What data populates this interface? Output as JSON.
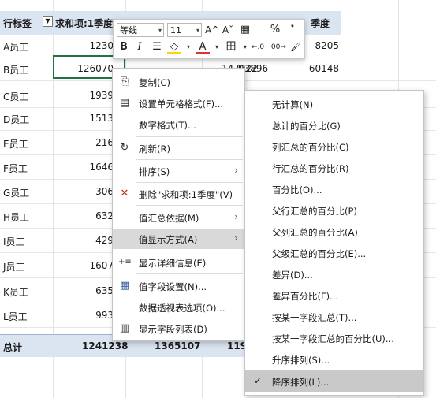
{
  "sheet": {
    "header": {
      "row_label": "行标签",
      "filter_icon": "▼",
      "col1": "求和项:1季度",
      "col4": "季度"
    },
    "rows": [
      {
        "label": "A员工",
        "q1": "1230",
        "q4": "8205"
      },
      {
        "label": "B员工",
        "q1": "126070",
        "q2": "147022",
        "q3": "93896",
        "q4": "60148"
      },
      {
        "label": "C员工",
        "q1": "1939"
      },
      {
        "label": "D员工",
        "q1": "1513"
      },
      {
        "label": "E员工",
        "q1": "216"
      },
      {
        "label": "F员工",
        "q1": "1646"
      },
      {
        "label": "G员工",
        "q1": "306"
      },
      {
        "label": "H员工",
        "q1": "632"
      },
      {
        "label": "I员工",
        "q1": "429"
      },
      {
        "label": "J员工",
        "q1": "1607"
      },
      {
        "label": "K员工",
        "q1": "635"
      },
      {
        "label": "L员工",
        "q1": "993"
      }
    ],
    "total": {
      "label": "总计",
      "q1": "1241238",
      "q2": "1365107",
      "q3": "119"
    }
  },
  "minibar": {
    "font": "等线",
    "size": "11",
    "icons": {
      "grow": "A^",
      "shrink": "Aˇ",
      "percent": "%",
      "comma": "❜",
      "bold": "B",
      "italic": "I",
      "align": "☰",
      "fill": "◇",
      "font_color": "A",
      "borders": "田",
      "dec_inc": "←.0",
      "dec_dec": ".00→",
      "brush": "🖌"
    }
  },
  "context_menu": {
    "items": [
      {
        "label": "复制(C)",
        "icon": "⎘"
      },
      {
        "label": "设置单元格格式(F)...",
        "icon": "▤"
      },
      {
        "label": "数字格式(T)...",
        "icon": ""
      },
      {
        "label": "刷新(R)",
        "icon": "↻"
      },
      {
        "label": "排序(S)",
        "icon": "",
        "arrow": "›"
      },
      {
        "label": "删除\"求和项:1季度\"(V)",
        "icon": "✕"
      },
      {
        "label": "值汇总依据(M)",
        "icon": "",
        "arrow": "›"
      },
      {
        "label": "值显示方式(A)",
        "icon": "",
        "arrow": "›"
      },
      {
        "label": "显示详细信息(E)",
        "icon": "+≡"
      },
      {
        "label": "值字段设置(N)...",
        "icon": "▦"
      },
      {
        "label": "数据透视表选项(O)...",
        "icon": ""
      },
      {
        "label": "显示字段列表(D)",
        "icon": "▥"
      }
    ]
  },
  "submenu": {
    "items": [
      {
        "label": "无计算(N)"
      },
      {
        "label": "总计的百分比(G)"
      },
      {
        "label": "列汇总的百分比(C)"
      },
      {
        "label": "行汇总的百分比(R)"
      },
      {
        "label": "百分比(O)..."
      },
      {
        "label": "父行汇总的百分比(P)"
      },
      {
        "label": "父列汇总的百分比(A)"
      },
      {
        "label": "父级汇总的百分比(E)..."
      },
      {
        "label": "差异(D)..."
      },
      {
        "label": "差异百分比(F)..."
      },
      {
        "label": "按某一字段汇总(T)..."
      },
      {
        "label": "按某一字段汇总的百分比(U)..."
      },
      {
        "label": "升序排列(S)..."
      },
      {
        "label": "降序排列(L)...",
        "check": "✓"
      }
    ]
  }
}
